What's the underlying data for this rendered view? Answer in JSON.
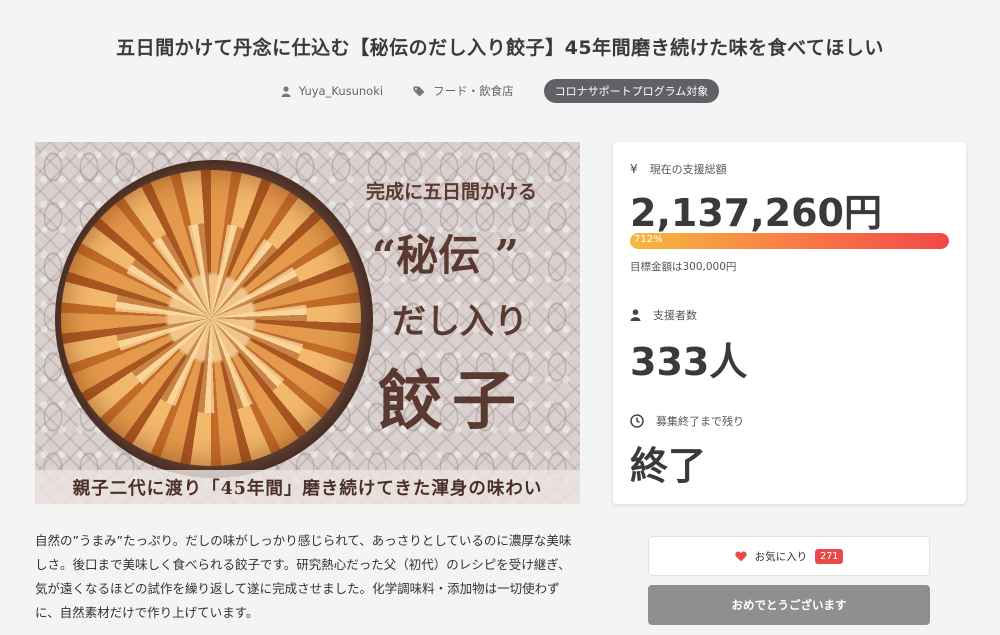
{
  "project": {
    "title": "五日間かけて丹念に仕込む【秘伝のだし入り餃子】45年間磨き続けた味を食べてほしい",
    "author": "Yuya_Kusunoki",
    "category": "フード・飲食店",
    "badge": "コロナサポートプログラム対象"
  },
  "hero": {
    "sub1": "完成に五日間かける",
    "big1": "“秘伝 ”",
    "big2": "だし入り",
    "big3": "餃子",
    "band": "親子二代に渡り「45年間」磨き続けてきた渾身の味わい"
  },
  "description": "自然の”うまみ”たっぷり。だしの味がしっかり感じられて、あっさりとしているのに濃厚な美味しさ。後口まで美味しく食べられる餃子です。研究熱心だった父（初代）のレシピを受け継ぎ、気が遠くなるほどの試作を繰り返して遂に完成させました。化学調味料・添加物は一切使わずに、自然素材だけで作り上げています。",
  "stats": {
    "funding_label": "現在の支援総額",
    "funding_value": "2,137,260円",
    "progress_text": "712%",
    "progress_fraction": 1.0,
    "goal_text": "目標金額は300,000円",
    "supporters_label": "支援者数",
    "supporters_value": "333人",
    "remaining_label": "募集終了まで残り",
    "remaining_value": "終了"
  },
  "actions": {
    "favorite_label": "お気に入り",
    "favorite_count": "271",
    "done_label": "おめでとうございます"
  },
  "icons": {
    "user": "user-icon",
    "tag": "tag-icon",
    "yen": "yen-icon",
    "supporters": "supporters-icon",
    "clock": "clock-icon",
    "heart": "heart-icon"
  },
  "colors": {
    "accent": "#e84a4a",
    "progress_start": "#f5b940",
    "progress_end": "#f04848",
    "badge_bg": "#5f6166",
    "done_bg": "#8f8f8f"
  }
}
